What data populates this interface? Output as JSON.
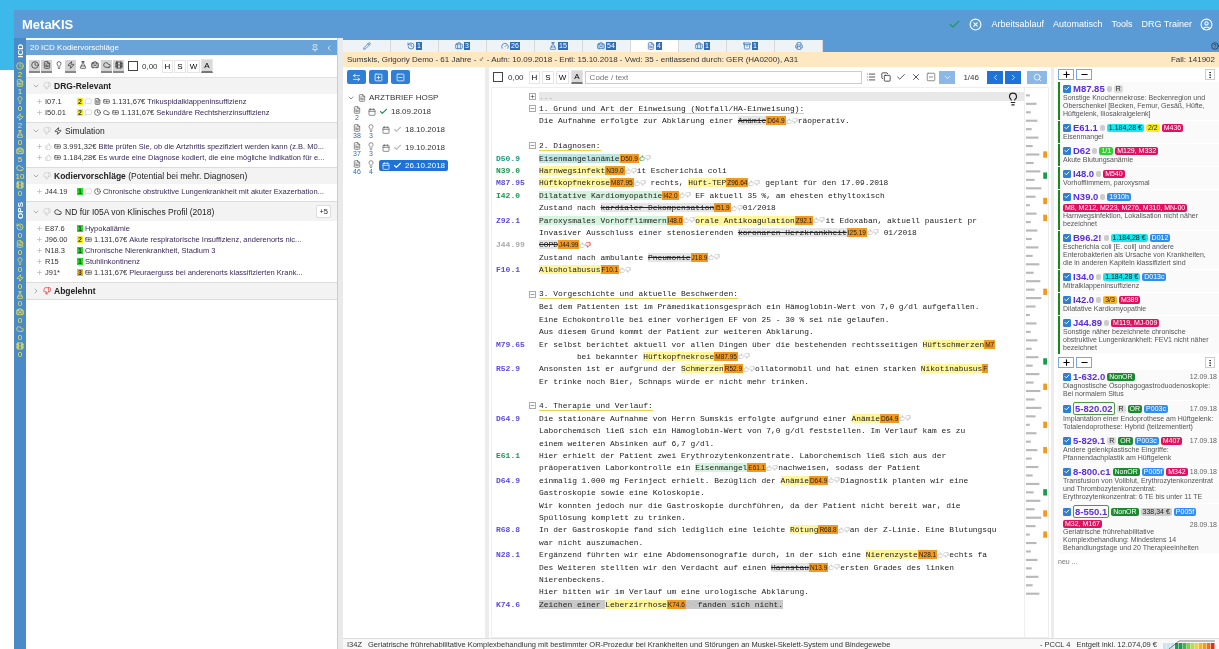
{
  "app": {
    "title": "MetaKIS",
    "menu": [
      "Arbeitsablauf",
      "Automatisch",
      "Tools",
      "DRG Trainer"
    ]
  },
  "strip": {
    "icd_label": "ICD",
    "icd": [
      {
        "kind": "clock",
        "count": "2"
      },
      {
        "kind": "document",
        "count": "1"
      },
      {
        "kind": "bulb",
        "count": "0"
      },
      {
        "kind": "bolt",
        "count": "2"
      },
      {
        "kind": "flask",
        "count": "0"
      },
      {
        "kind": "medkit",
        "count": "5"
      },
      {
        "kind": "cloud",
        "count": "10"
      },
      {
        "kind": "film",
        "count": "0"
      }
    ],
    "ops_label": "OPS",
    "ops": [
      {
        "kind": "history",
        "count": "0"
      },
      {
        "kind": "document",
        "count": "0"
      },
      {
        "kind": "bulb",
        "count": "0"
      },
      {
        "kind": "bolt",
        "count": "0"
      },
      {
        "kind": "flask",
        "count": "0"
      },
      {
        "kind": "medkit",
        "count": "0"
      },
      {
        "kind": "cloud",
        "count": "0"
      },
      {
        "kind": "film",
        "count": "0"
      }
    ]
  },
  "left_panel": {
    "title": "20 ICD Kodiervorschläge",
    "filters": [
      {
        "kind": "clock",
        "pressed": true
      },
      {
        "kind": "document",
        "pressed": true
      },
      {
        "kind": "bulb",
        "pressed": false
      },
      {
        "kind": "bolt",
        "pressed": true
      },
      {
        "kind": "flask",
        "pressed": false
      },
      {
        "kind": "medkit",
        "pressed": false
      },
      {
        "kind": "cloud",
        "pressed": true
      },
      {
        "kind": "film",
        "pressed": true
      }
    ],
    "amount_checked": false,
    "amount": "0,00",
    "toggles": [
      {
        "label": "H",
        "selected": false
      },
      {
        "label": "S",
        "selected": false
      },
      {
        "label": "W",
        "selected": false
      },
      {
        "label": "A",
        "selected": true
      }
    ],
    "groups": [
      {
        "title": "DRG-Relevant",
        "bold": true,
        "kind": "plain",
        "expanded": true,
        "rows": [
          {
            "code": "I07.1",
            "score": "2",
            "color": "#f7ee1e",
            "icons": [
              {
                "kind": "comment"
              },
              {
                "kind": "document"
              },
              {
                "kind": "money"
              }
            ],
            "amount": "1.131,67€",
            "text": "Trikuspidalklappeninsuffizienz"
          },
          {
            "code": "I50.01",
            "score": "2",
            "color": "#f7ee1e",
            "icons": [
              {
                "kind": "comment"
              },
              {
                "kind": "clock"
              },
              {
                "kind": "cloud"
              },
              {
                "kind": "money"
              }
            ],
            "amount": "1.131,67€",
            "text": "Sekundäre Rechtsherzinsuffizienz"
          }
        ]
      },
      {
        "title": "Simulation",
        "bold": false,
        "kind": "bolt",
        "expanded": true,
        "rows": [
          {
            "icons": [
              {
                "kind": "like"
              },
              {
                "kind": "money"
              }
            ],
            "amount": "3.991,32€",
            "text": "Bitte prüfen Sie, ob die Artzhritis spezifiziert werden kann (z.B. M0..."
          },
          {
            "icons": [
              {
                "kind": "like"
              },
              {
                "kind": "money"
              }
            ],
            "amount": "1.184,28€",
            "text": "Es wurde eine Diagnose kodiert, die eine mögliche Indikation für e..."
          }
        ]
      },
      {
        "title": "**Kodiervorschläge** (Potential bei mehr. Diagnosen)",
        "bold": false,
        "kind": "plain",
        "expanded": true,
        "rows": [
          {
            "code": "J44.19",
            "score": "1",
            "color": "#22dd22",
            "icons": [
              {
                "kind": "comment"
              },
              {
                "kind": "clock"
              }
            ],
            "text": "Chronische obstruktive Lungenkrankheit mit akuter Exazerbation..."
          }
        ]
      },
      {
        "title": "ND für I05A von Klinisches Profil (2018)",
        "bold": false,
        "kind": "cloud",
        "expanded": true,
        "badge": "+5",
        "rows": [
          {
            "code": "E87.6",
            "score": "1",
            "color": "#22dd22",
            "text": "Hypokaliämie"
          },
          {
            "code": "J96.00",
            "score": "2",
            "color": "#f7ee1e",
            "icons": [
              {
                "kind": "money"
              }
            ],
            "amount": "1.131,67€",
            "text": "Akute respiratorische Insuffizienz, anderenorts nic..."
          },
          {
            "code": "N18.3",
            "score": "1",
            "color": "#22dd22",
            "text": "Chronische Nierenkrankheit, Stadium 3"
          },
          {
            "code": "R15",
            "score": "1",
            "color": "#22dd22",
            "text": "Stuhlinkontinenz"
          },
          {
            "code": "J91*",
            "score": "3",
            "color": "#f5b324",
            "icons": [
              {
                "kind": "money"
              }
            ],
            "amount": "1.131,67€",
            "text": "Pleuraerguss bei anderenorts klassifizierten Krank..."
          }
        ]
      },
      {
        "title": "Abgelehnt",
        "bold": true,
        "kind": "rejected",
        "expanded": false
      }
    ]
  },
  "tabs": [
    {
      "kind": "edit",
      "selected": false
    },
    {
      "kind": "history",
      "count": "1",
      "selected": false
    },
    {
      "kind": "case",
      "count": "3",
      "selected": false
    },
    {
      "kind": "gauge",
      "count": "26",
      "selected": false
    },
    {
      "kind": "flask",
      "count": "15",
      "selected": false
    },
    {
      "kind": "medkit",
      "count": "54",
      "selected": false
    },
    {
      "kind": "document",
      "count": "4",
      "selected": true
    },
    {
      "kind": "briefcase",
      "count": "1",
      "selected": false
    },
    {
      "kind": "archive",
      "count": "1",
      "selected": false
    },
    {
      "kind": "print",
      "selected": false
    }
  ],
  "patient": {
    "info": "Sumskis, Grigoriy Demo - 61 Jahre - ♂ - Aufn: 10.09.2018 - Entl: 15.10.2018 - Vwd: 35 - entlassend durch: GER (HA0200), A31",
    "case": "Fall: 141902"
  },
  "documents": {
    "title": "ARZTBRIEF HOSP",
    "expanded": true,
    "items": [
      {
        "date": "18.09.2018",
        "confirmed": true,
        "selected": false,
        "counts": [
          "2"
        ]
      },
      {
        "date": "18.10.2018",
        "confirmed": false,
        "selected": false,
        "counts": [
          "38",
          "3"
        ]
      },
      {
        "date": "19.10.2018",
        "confirmed": false,
        "selected": false,
        "counts": [
          "37",
          "3"
        ]
      },
      {
        "date": "26.10.2018",
        "confirmed": true,
        "selected": true,
        "counts": [
          "46",
          "4"
        ]
      }
    ]
  },
  "editor": {
    "amount_checked": false,
    "amount": "0,00",
    "toggles": [
      {
        "label": "H",
        "selected": false
      },
      {
        "label": "S",
        "selected": false
      },
      {
        "label": "W",
        "selected": false
      },
      {
        "label": "A",
        "selected": true
      }
    ],
    "search": {
      "placeholder": "Code / text"
    },
    "position": "1/46",
    "lines": [
      {
        "kind": "collapsed",
        "text": "..."
      },
      {
        "kind": "heading",
        "text": "1. Grund und Art der Einweisung (Notfall/HA-Einweisung):"
      },
      {
        "kind": "text",
        "parts": [
          {
            "text": "Die Aufnahme erfolgte zur Abklärung einer "
          },
          {
            "term": "Anämie",
            "tag": "D64.9",
            "kind": "struck",
            "up": false,
            "down": false
          },
          {
            "text": "räoperativ."
          }
        ]
      },
      {
        "kind": "blank"
      },
      {
        "kind": "heading",
        "text": "2. Diagnosen:"
      },
      {
        "kind": "text",
        "code": "D50.9",
        "color": "#1d9a7a",
        "parts": [
          {
            "term": "Eisenmangelanämie",
            "tag": "D50.9",
            "kind": "teal",
            "up": true,
            "down": false
          }
        ]
      },
      {
        "kind": "text",
        "code": "N39.0",
        "color": "#1d9a4e",
        "parts": [
          {
            "term": "Harnwegsinfekt",
            "tag": "N39.0",
            "kind": "yellow",
            "up": false,
            "down": false
          },
          {
            "text": "it Escherichia coli"
          }
        ]
      },
      {
        "kind": "text",
        "code": "M87.95",
        "color": "#5b4be0",
        "parts": [
          {
            "term": "Hüftkopfnekrose",
            "tag": "M87.95",
            "kind": "yellow",
            "up": false,
            "down": false
          },
          {
            "text": " rechts, "
          },
          {
            "term": "Hüft-TEP",
            "tag": "Z96.64",
            "kind": "yellow",
            "up": false,
            "down": false
          },
          {
            "text": " geplant für den 17.09.2018"
          }
        ]
      },
      {
        "kind": "text",
        "code": "I42.0",
        "color": "#1d9a4e",
        "parts": [
          {
            "term": "Dilatative Kardiomyopathie",
            "tag": "I42.0",
            "kind": "green",
            "up": false,
            "down": false
          },
          {
            "text": " EF aktuell 35 %, am ehesten ethyltoxisch"
          }
        ]
      },
      {
        "kind": "text",
        "parts": [
          {
            "text": "Zustand nach "
          },
          {
            "term": "kardialer Dekompensation",
            "tag": "I51.9",
            "kind": "struck",
            "up": false,
            "down": false
          },
          {
            "text": "01/2018"
          }
        ]
      },
      {
        "kind": "text",
        "code": "Z92.1",
        "color": "#5b4be0",
        "parts": [
          {
            "term": "Paroxysmales Vorhofflimmern",
            "tag": "I48.0",
            "kind": "green",
            "up": false,
            "down": false
          },
          {
            "term": "orale Antikoagulation",
            "tag": "Z92.1",
            "kind": "yellow",
            "up": false,
            "down": false
          },
          {
            "text": "it Edoxaban, aktuell pausiert pr"
          }
        ]
      },
      {
        "kind": "text",
        "parts": [
          {
            "text": "Invasiver Ausschluss einer stenosierenden "
          },
          {
            "term": "koronaren Herzkrankheit",
            "tag": "I25.19",
            "kind": "struck",
            "up": false,
            "down": false
          },
          {
            "text": " 01/2018"
          }
        ]
      },
      {
        "kind": "text",
        "code": "J44.99",
        "color": "#aaaaaa",
        "parts": [
          {
            "term": "COPD",
            "tag": "J44.99",
            "kind": "struck",
            "up": false,
            "down": true
          }
        ]
      },
      {
        "kind": "text",
        "parts": [
          {
            "text": "Zustand nach ambulante "
          },
          {
            "term": "Pneumonie",
            "tag": "J18.9",
            "kind": "struck",
            "up": false,
            "down": false
          }
        ]
      },
      {
        "kind": "text",
        "code": "F10.1",
        "color": "#5b4be0",
        "parts": [
          {
            "term": "Alkoholabusus",
            "tag": "F10.1",
            "kind": "yellow",
            "up": false,
            "down": false
          }
        ]
      },
      {
        "kind": "blank"
      },
      {
        "kind": "heading",
        "text": "3. Vorgeschichte und aktuelle Beschwerden:"
      },
      {
        "kind": "text",
        "parts": [
          {
            "text": "Bei dem Patienten ist im Prämedikationsgespräch ein Hämoglobin-Wert von 7,0 g/dl aufgefallen."
          }
        ]
      },
      {
        "kind": "text",
        "parts": [
          {
            "text": "Eine Echokontrolle bei einer vorherigen EF von 25 - 30 % sei nie gelaufen."
          }
        ]
      },
      {
        "kind": "text",
        "parts": [
          {
            "text": "Aus diesem Grund kommt der Patient zur weiteren Abklärung."
          }
        ]
      },
      {
        "kind": "text",
        "code": "M79.65",
        "color": "#5b4be0",
        "parts": [
          {
            "text": "Er selbst berichtet aktuell vor allen Dingen über die bestehenden rechtsseitigen "
          },
          {
            "term": "Hüftschmerzen",
            "tag": "M7",
            "kind": "yellow"
          }
        ]
      },
      {
        "kind": "text",
        "parts": [
          {
            "text": "        bei bekannter "
          },
          {
            "term": "Hüftkopfnekrose",
            "tag": "M87.95",
            "kind": "yellow",
            "up": false,
            "down": false
          }
        ]
      },
      {
        "kind": "text",
        "code": "R52.9",
        "color": "#5b4be0",
        "parts": [
          {
            "text": "Ansonsten ist er aufgrund der "
          },
          {
            "term": "Schmerzen",
            "tag": "R52.9",
            "kind": "yellow",
            "up": false,
            "down": false
          },
          {
            "text": "ollatormobil und hat einen starken "
          },
          {
            "term": "Nikotinabusus",
            "tag": "F",
            "kind": "yellow"
          }
        ]
      },
      {
        "kind": "text",
        "parts": [
          {
            "text": "Er trinke noch Bier, Schnaps würde er nicht mehr trinken."
          }
        ]
      },
      {
        "kind": "blank"
      },
      {
        "kind": "heading",
        "text": "4. Therapie und Verlauf:"
      },
      {
        "kind": "text",
        "code": "D64.9",
        "color": "#5b4be0",
        "parts": [
          {
            "text": "Die stationäre Aufnahme von Herrn Sumskis erfolgte aufgrund einer "
          },
          {
            "term": "Anämie",
            "tag": "D64.9",
            "kind": "yellow",
            "up": false,
            "down": false
          }
        ]
      },
      {
        "kind": "text",
        "parts": [
          {
            "text": "Laborchemisch ließ sich ein Hämoglobin-Wert von 7,0 g/dl feststellen. Im Verlauf kam es zu"
          }
        ]
      },
      {
        "kind": "text",
        "parts": [
          {
            "text": "einem weiteren Absinken auf 6,7 g/dl."
          }
        ]
      },
      {
        "kind": "text",
        "code": "E61.1",
        "color": "#1d9a4e",
        "parts": [
          {
            "text": "Hier erhielt der Patient zwei Erythrozytenkonzentrate. Laborchemisch ließ sich aus der"
          }
        ]
      },
      {
        "kind": "text",
        "parts": [
          {
            "text": "präoperativen Laborkontrolle ein "
          },
          {
            "term": "Eisenmangel",
            "tag": "E61.1",
            "kind": "green",
            "up": false,
            "down": false
          },
          {
            "text": "nachweisen, sodass der Patient"
          }
        ]
      },
      {
        "kind": "text",
        "code": "D64.9",
        "color": "#5b4be0",
        "parts": [
          {
            "text": "einmalig 1.000 mg Ferinject erhielt. Bezüglich der "
          },
          {
            "term": "Anämie",
            "tag": "D64.9",
            "kind": "yellow",
            "up": false,
            "down": false
          },
          {
            "text": "Diagnostik planten wir eine"
          }
        ]
      },
      {
        "kind": "text",
        "parts": [
          {
            "text": "Gastroskopie sowie eine Koloskopie."
          }
        ]
      },
      {
        "kind": "text",
        "parts": [
          {
            "text": "Wir konnten jedoch nur die Gastroskopie durchführen, da der Patient nicht bereit war, die"
          }
        ]
      },
      {
        "kind": "text",
        "parts": [
          {
            "text": "Spüllösung komplett zu trinken."
          }
        ]
      },
      {
        "kind": "text",
        "code": "R68.8",
        "color": "#5b4be0",
        "parts": [
          {
            "text": "In der Gastroskopie fand sich lediglich eine leichte "
          },
          {
            "term": "Rötung",
            "tag": "R68.8",
            "kind": "yellow",
            "up": false,
            "down": false
          },
          {
            "text": "an der Z-Linie. Eine Blutungsqu"
          }
        ]
      },
      {
        "kind": "text",
        "parts": [
          {
            "text": "war nicht auszumachen."
          }
        ]
      },
      {
        "kind": "text",
        "code": "N28.1",
        "color": "#5b4be0",
        "parts": [
          {
            "text": "Ergänzend führten wir eine Abdomensonografie durch, in der sich eine "
          },
          {
            "term": "Nierenzyste",
            "tag": "N28.1",
            "kind": "yellow",
            "up": false,
            "down": false
          },
          {
            "text": "echts fa"
          }
        ]
      },
      {
        "kind": "text",
        "parts": [
          {
            "text": "Des Weiteren stellten wir den Verdacht auf einen "
          },
          {
            "term": "Harnstau",
            "tag": "N13.9",
            "kind": "struck",
            "up": false,
            "down": false
          },
          {
            "text": "ersten Grades des linken"
          }
        ]
      },
      {
        "kind": "text",
        "parts": [
          {
            "text": "Nierenbeckens."
          }
        ]
      },
      {
        "kind": "text",
        "parts": [
          {
            "text": "Hier bitten wir im Verlauf um eine urologische Abklärung."
          }
        ]
      },
      {
        "kind": "cursor",
        "code": "K74.6",
        "color": "#5b4be0",
        "parts": [
          {
            "text": "Zeichen einer "
          },
          {
            "term": "Leberzirrhose",
            "tag": "K74.6",
            "kind": "yellow",
            "up": false,
            "down": false
          },
          {
            "text": "fanden sich nicht."
          }
        ]
      }
    ]
  },
  "diagnoses": [
    {
      "code": "M87.85",
      "checked": true,
      "badges": [
        {
          "text": "R",
          "color": "#dddddd"
        }
      ],
      "desc": "Sonstige Knochennekrose: Beckenregion und Oberschenkel [Becken, Femur, Gesäß, Hüfte, Hüftgelenk, Iliosakralgelenk]"
    },
    {
      "code": "E61.1",
      "checked": true,
      "badges": [
        {
          "text": "1.184,28 €",
          "color": "#19e6ee"
        },
        {
          "text": "2/2",
          "color": "#f7ee1e"
        },
        {
          "text": "M436",
          "color": "#e0115f"
        }
      ],
      "desc": "Eisenmangel"
    },
    {
      "code": "D62",
      "checked": true,
      "badges": [
        {
          "text": "1/1",
          "color": "#2fd12f"
        },
        {
          "text": "M129, M332",
          "color": "#e0115f"
        }
      ],
      "desc": "Akute Blutungsanämie"
    },
    {
      "code": "I48.0",
      "checked": true,
      "badges": [
        {
          "text": "M540",
          "color": "#e0115f"
        }
      ],
      "desc": "Vorhofflimmern, paroxysmal"
    },
    {
      "code": "N39.0",
      "checked": true,
      "badges": [
        {
          "text": "1910h",
          "color": "#2f8ff0"
        },
        {
          "text": "M8, M212, M223, M276, M310, MN-00",
          "color": "#e0115f"
        }
      ],
      "desc": "Harnwegsinfektion, Lokalisation nicht näher bezeichnet"
    },
    {
      "code": "B96.2!",
      "checked": true,
      "badges": [
        {
          "text": "1.184,28 €",
          "color": "#19e6ee"
        },
        {
          "text": "D012",
          "color": "#2f8ff0"
        }
      ],
      "desc": "Escherichia coli [E. coli] und andere Enterobakterien als Ursache von Krankheiten, die in anderen Kapiteln klassifiziert sind"
    },
    {
      "code": "I34.0",
      "checked": true,
      "badges": [
        {
          "text": "1.184,28 €",
          "color": "#19e6ee"
        },
        {
          "text": "D013c",
          "color": "#2f8ff0"
        }
      ],
      "desc": "Mitralklappeninsuffizienz"
    },
    {
      "code": "I42.0",
      "checked": true,
      "badges": [
        {
          "text": "3/3",
          "color": "#f5b324"
        },
        {
          "text": "M389",
          "color": "#e0115f"
        }
      ],
      "desc": "Dilatative Kardiomyopathie"
    },
    {
      "code": "J44.89",
      "checked": true,
      "badges": [
        {
          "text": "M119, MJ-009",
          "color": "#e0115f"
        }
      ],
      "desc": "Sonstige näher bezeichnete chronische obstruktive Lungenkrankheit: FEV1 nicht näher bezeichnet"
    }
  ],
  "procedures": [
    {
      "code": "1-632.0",
      "checked": true,
      "boxed": false,
      "date": "12.09.18",
      "badges": [
        {
          "text": "NonOR",
          "color": "#1b8a2e"
        }
      ],
      "desc": "Diagnostische Ösophagogastroduodenoskopie: Bei normalem Situs"
    },
    {
      "code": "5-820.02",
      "checked": true,
      "boxed": true,
      "date": "17.09.18",
      "badges": [
        {
          "text": "R",
          "color": "#dddddd"
        },
        {
          "text": "OR",
          "color": "#1b8a2e"
        },
        {
          "text": "P003c",
          "color": "#2f8ff0"
        }
      ],
      "desc": "Implantation einer Endoprothese am Hüftgelenk: Totalendoprothese: Hybrid (teilzementiert)"
    },
    {
      "code": "5-829.1",
      "checked": true,
      "boxed": false,
      "date": "17.09.18",
      "badges": [
        {
          "text": "R",
          "color": "#dddddd"
        },
        {
          "text": "OR",
          "color": "#1b8a2e"
        },
        {
          "text": "P003c",
          "color": "#2f8ff0"
        },
        {
          "text": "M407",
          "color": "#e0115f"
        }
      ],
      "desc": "Andere gelenkplastische Eingriffe: Pfannendachplastik am Hüftgelenk"
    },
    {
      "code": "8-800.c1",
      "checked": true,
      "boxed": false,
      "date": "18.09.18",
      "badges": [
        {
          "text": "NonOR",
          "color": "#1b8a2e"
        },
        {
          "text": "P005f",
          "color": "#2f8ff0"
        },
        {
          "text": "M342",
          "color": "#e0115f"
        }
      ],
      "desc": "Transfusion von Vollblut, Erythrozytenkonzentrat und Thrombozytenkonzentrat: Erythrozytenkonzentrat: 6 TE bis unter 11 TE"
    },
    {
      "code": "8-550.1",
      "checked": true,
      "boxed": true,
      "date": "28.09.18",
      "badges": [
        {
          "text": "NonOR",
          "color": "#1b8a2e"
        },
        {
          "text": "338,34 €",
          "color": "#cccccc"
        },
        {
          "text": "P005f",
          "color": "#2f8ff0"
        },
        {
          "text": "M32, M167",
          "color": "#e0115f"
        }
      ],
      "desc": "Geriatrische frührehabilitative Komplexbehandlung: Mindestens 14 Behandlungstage und 20 Therapieeinheiten"
    }
  ],
  "new_procedure": {
    "placeholder": "neu ..."
  },
  "status_bar": {
    "drg": "I34Z",
    "text": "Geriatrische frührehabilitative Komplexbehandlung mit bestimmter OR-Prozedur bei Krankheiten und Störungen an Muskel-Skelett-System und Bindegewebe",
    "pccl": "- PCCL 4",
    "price": "Entgelt inkl. 12.074,09 €"
  }
}
